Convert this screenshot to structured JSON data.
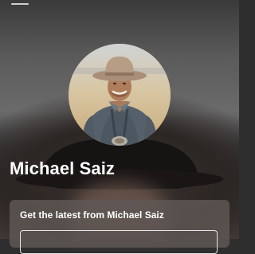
{
  "profile": {
    "name": "Michael Saiz"
  },
  "subscribe": {
    "heading": "Get the latest from Michael Saiz",
    "email_value": ""
  },
  "icons": {
    "menu": "menu-icon"
  }
}
